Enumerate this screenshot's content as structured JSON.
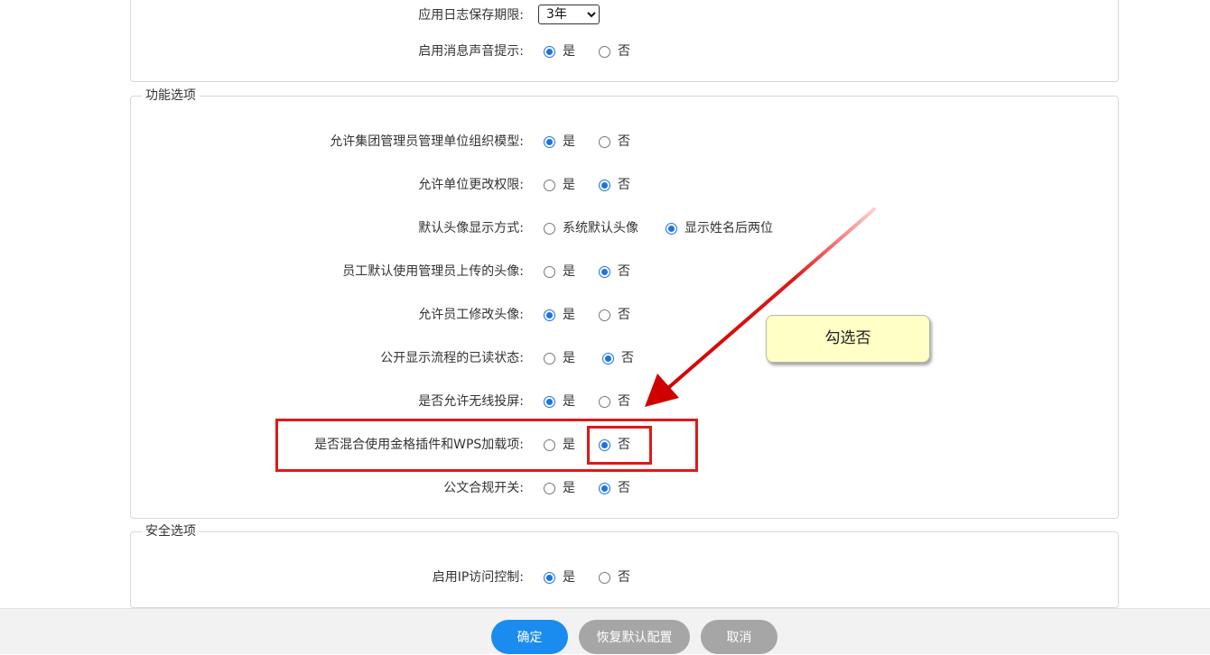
{
  "top_panel": {
    "log_retention": {
      "label": "应用日志保存期限:",
      "value": "3年"
    },
    "sound_alert": {
      "label": "启用消息声音提示:",
      "options": [
        "是",
        "否"
      ],
      "selected": 0
    }
  },
  "features": {
    "legend": "功能选项",
    "rows": [
      {
        "label": "允许集团管理员管理单位组织模型:",
        "options": [
          "是",
          "否"
        ],
        "selected": 0
      },
      {
        "label": "允许单位更改权限:",
        "options": [
          "是",
          "否"
        ],
        "selected": 1
      },
      {
        "label": "默认头像显示方式:",
        "options": [
          "系统默认头像",
          "显示姓名后两位"
        ],
        "selected": 1
      },
      {
        "label": "员工默认使用管理员上传的头像:",
        "options": [
          "是",
          "否"
        ],
        "selected": 1
      },
      {
        "label": "允许员工修改头像:",
        "options": [
          "是",
          "否"
        ],
        "selected": 0
      },
      {
        "label": "公开显示流程的已读状态:",
        "options": [
          "是",
          "否"
        ],
        "selected": 1
      },
      {
        "label": "是否允许无线投屏:",
        "options": [
          "是",
          "否"
        ],
        "selected": 0
      },
      {
        "label": "是否混合使用金格插件和WPS加载项:",
        "options": [
          "是",
          "否"
        ],
        "selected": 1
      },
      {
        "label": "公文合规开关:",
        "options": [
          "是",
          "否"
        ],
        "selected": 1
      }
    ]
  },
  "security": {
    "legend": "安全选项",
    "ip_control": {
      "label": "启用IP访问控制:",
      "options": [
        "是",
        "否"
      ],
      "selected": 0
    }
  },
  "footer": {
    "confirm": "确定",
    "restore": "恢复默认配置",
    "cancel": "取消"
  },
  "annotation": {
    "callout_text": "勾选否",
    "highlight_color": "#e01818"
  },
  "colors": {
    "accent": "#1a73e8",
    "primary_button": "#1a8cf0",
    "gray_button": "#a6a6a6"
  }
}
